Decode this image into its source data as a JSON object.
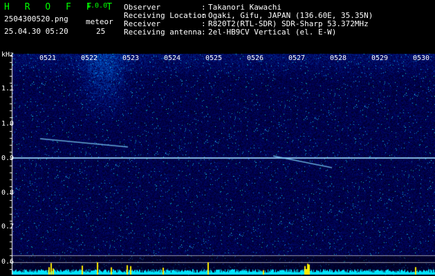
{
  "header": {
    "app_name": "H R O F F T",
    "version": "1.0.0",
    "filename": "2504300520.png",
    "datetime": "25.04.30 05:20",
    "meteor_label": "meteor",
    "meteor_count": "25"
  },
  "info": [
    {
      "label": "Observer",
      "value": "Takanori Kawachi"
    },
    {
      "label": "Receiving Location",
      "value": "Ogaki, Gifu, JAPAN (136.60E, 35.35N)"
    },
    {
      "label": "Receiver",
      "value": "R820T2(RTL-SDR) SDR-Sharp 53.372MHz"
    },
    {
      "label": "Receiving antenna",
      "value": "2el-HB9CV Vertical (el. E-W)"
    }
  ],
  "info_sep": ":",
  "y_axis": {
    "unit": "kHz",
    "ticks": [
      "1.1",
      "1.0",
      "0.9",
      "0.8",
      "0.7",
      "0.6"
    ]
  },
  "x_axis": {
    "ticks": [
      "0521",
      "0522",
      "0523",
      "0524",
      "0525",
      "0526",
      "0527",
      "0528",
      "0529",
      "0530"
    ]
  },
  "colors": {
    "background": "#000000",
    "noise_base": "#000a5a",
    "signal_line": "#9fdcff",
    "trace": "#7fd6ff",
    "bottom_bar": "#00e5ff",
    "bottom_spike": "#ffee00",
    "title_green": "#00ff00"
  }
}
